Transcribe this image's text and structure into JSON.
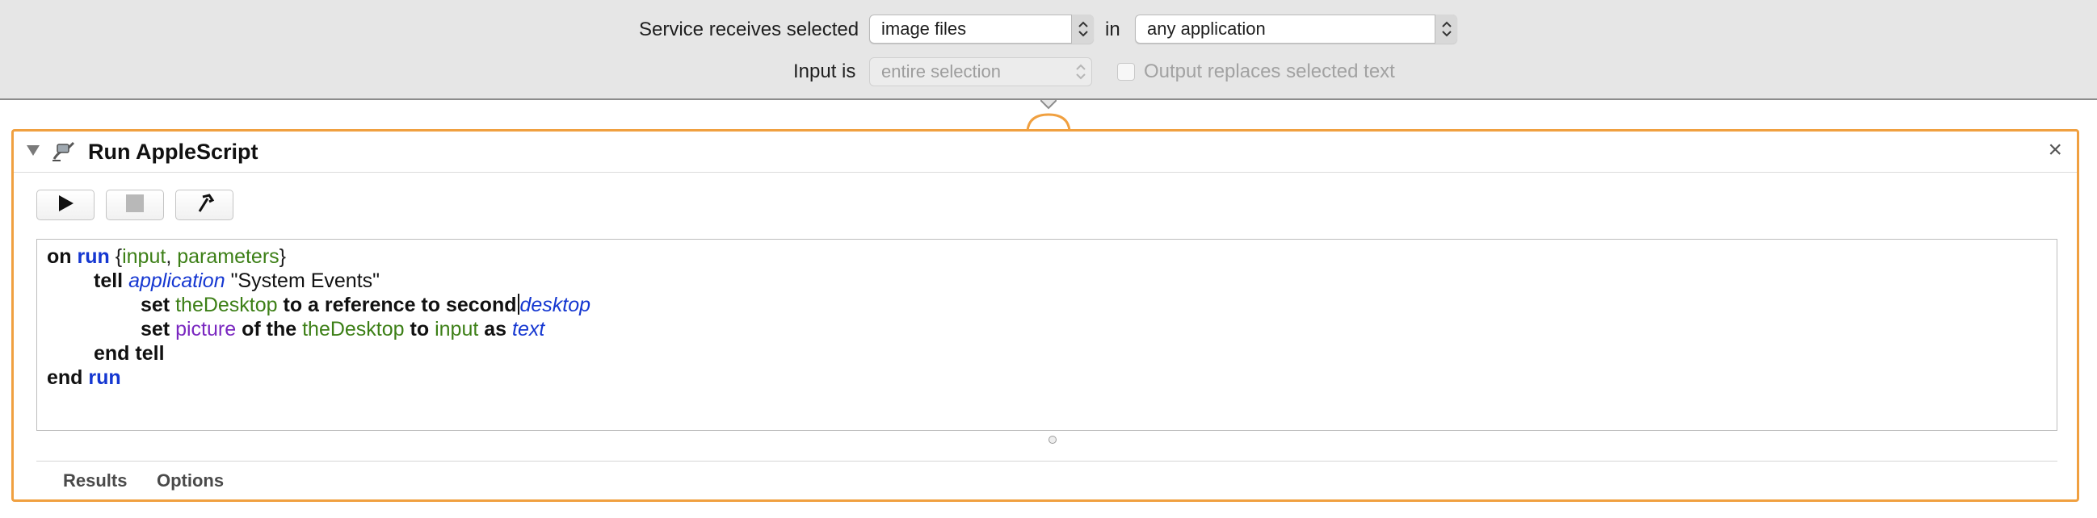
{
  "service": {
    "receives_label": "Service receives selected",
    "receives_value": "image files",
    "in_label": "in",
    "application_value": "any application",
    "input_label": "Input is",
    "input_value": "entire selection",
    "output_replaces_label": "Output replaces selected text",
    "output_replaces_checked": false
  },
  "action": {
    "title": "Run AppleScript",
    "close_glyph": "×",
    "toolbar": {
      "run_icon": "play-icon",
      "stop_icon": "stop-icon",
      "compile_icon": "hammer-icon"
    },
    "code": {
      "l1": {
        "t1": "on",
        "t2": "run",
        "t3": "{",
        "t4": "input",
        "t5": ", ",
        "t6": "parameters",
        "t7": "}"
      },
      "l2": {
        "t1": "tell",
        "t2": "application",
        "t3": "\"System Events\""
      },
      "l3": {
        "t1": "set",
        "t2": "theDesktop",
        "t3": "to a reference to second",
        "t4": "desktop"
      },
      "l4": {
        "t1": "set",
        "t2": "picture",
        "t3": "of the",
        "t4": "theDesktop",
        "t5": "to",
        "t6": "input",
        "t7": "as",
        "t8": "text"
      },
      "l5": {
        "t1": "end tell"
      },
      "l6": {
        "t1": "end",
        "t2": "run"
      }
    },
    "tabs": [
      "Results",
      "Options"
    ]
  },
  "colors": {
    "accent_border": "#f0a040",
    "keyword_blue": "#1537d1",
    "variable_green": "#3c7f16",
    "property_purple": "#7a27c0"
  }
}
